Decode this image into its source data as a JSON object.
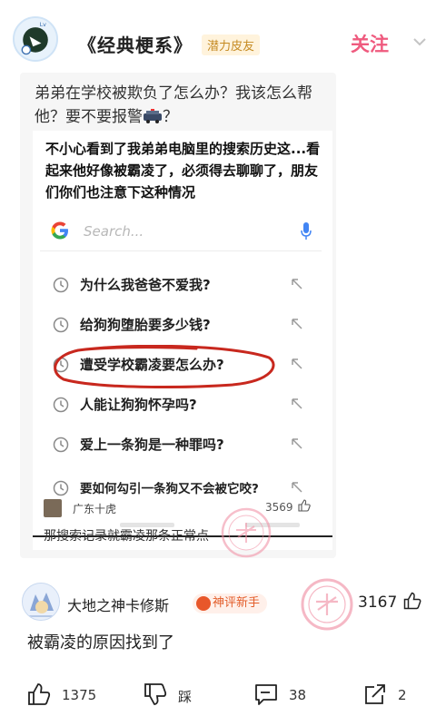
{
  "header": {
    "topic_title": "《经典梗系》",
    "topic_badge": "潜力皮友",
    "follow_label": "关注",
    "chevron_icon": "chevron-down-icon"
  },
  "quoted_post": {
    "question": "弟弟在学校被欺负了怎么办？我该怎么帮他？要不要报警",
    "question_suffix": "？",
    "screenshot": {
      "caption": "不小心看到了我弟弟电脑里的搜索历史这...看起来他好像被霸凌了，必须得去聊聊了，朋友们你们也注意下这种情况",
      "search_placeholder": "Search...",
      "suggestions": [
        "为什么我爸爸不爱我?",
        "给狗狗堕胎要多少钱?",
        "遭受学校霸凌要怎么办?",
        "人能让狗狗怀孕吗?",
        "爱上一条狗是一种罪吗?",
        "要如何勾引一条狗又不会被它咬?"
      ]
    },
    "reply": {
      "author": "广东十虎",
      "likes": "3569",
      "text": "那搜索记录就霸凌那条正常点"
    }
  },
  "comment": {
    "author": "大地之神卡修斯",
    "badge": "神评新手",
    "likes": "3167",
    "text": "被霸凌的原因找到了"
  },
  "actions": {
    "like_count": "1375",
    "dislike_label": "踩",
    "comment_count": "38",
    "share_count": "2"
  },
  "colors": {
    "accent_pink": "#ef5a7e",
    "badge_gold": "#c58a22",
    "badge_orange": "#e35d2a",
    "circle_red": "#c8281e"
  }
}
